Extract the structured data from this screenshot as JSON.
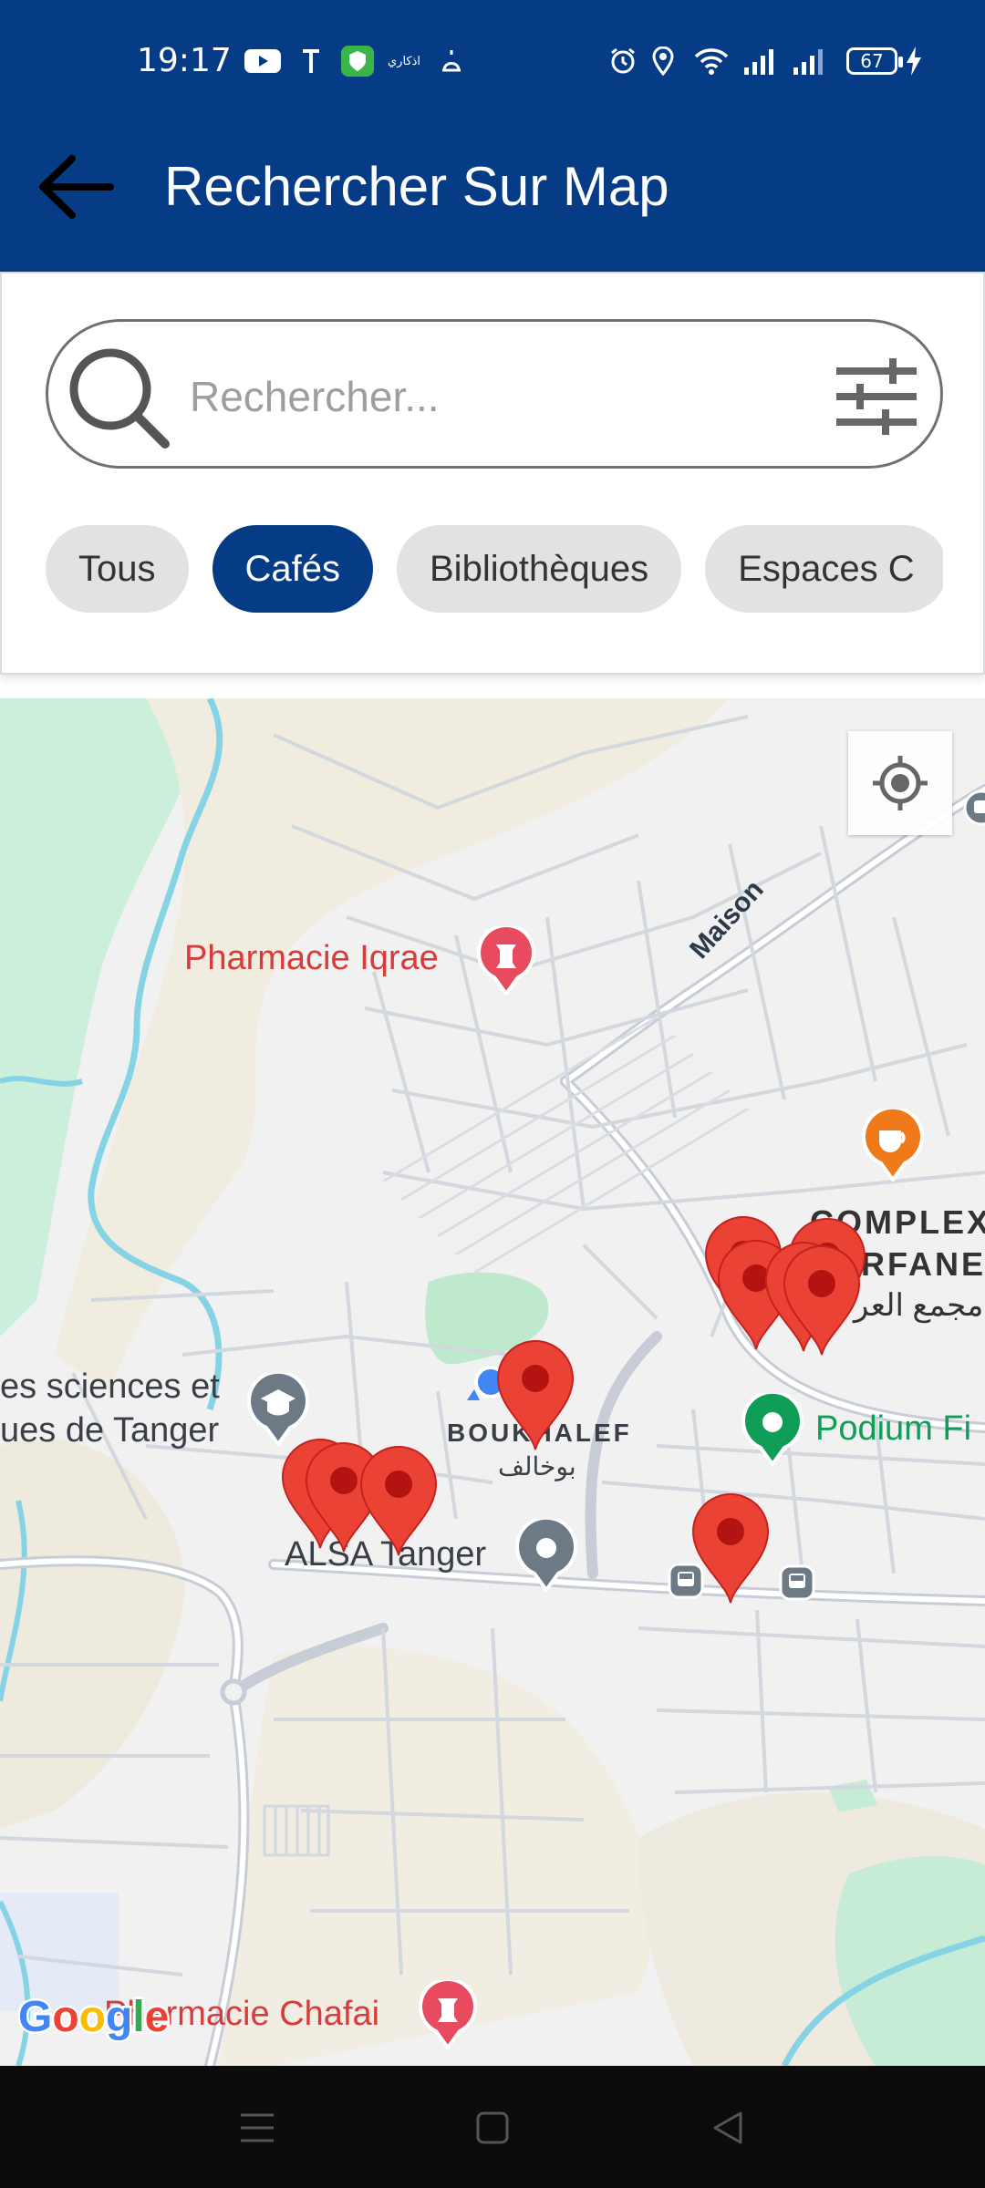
{
  "status_bar": {
    "time": "19:17",
    "battery": "67",
    "notification_text": "اذكاري"
  },
  "app_bar": {
    "title": "Rechercher Sur Map",
    "back_icon": "arrow-left-icon"
  },
  "search": {
    "placeholder": "Rechercher...",
    "value": "",
    "search_icon": "search-icon",
    "filter_icon": "sliders-icon"
  },
  "filters": {
    "chips": [
      {
        "label": "Tous",
        "active": false
      },
      {
        "label": "Cafés",
        "active": true
      },
      {
        "label": "Bibliothèques",
        "active": false
      },
      {
        "label": "Espaces C",
        "active": false
      }
    ]
  },
  "map": {
    "labels": {
      "pharmacie_iqrae": "Pharmacie Iqrae",
      "maison": "Maison",
      "complex_line1": "COMPLEX",
      "complex_line2": "RFANE",
      "complex_arabic": "مجمع العر",
      "sciences_line1": "es sciences et",
      "sciences_line2": "ues de Tanger",
      "boukhalef": "BOUKHALEF",
      "boukhalef_arabic": "بوخالف",
      "podium": "Podium Fi",
      "alsa": "ALSA Tanger",
      "pharmacie_chafai": "Pharmacie Chafai",
      "google": "Google"
    },
    "colors": {
      "marker": "#ea4335",
      "marker_dark": "#b31412",
      "pharmacy_label": "#d93b3b",
      "podium_label": "#0f9d58",
      "primary": "#063b86"
    }
  },
  "nav_bar": {
    "menu_icon": "menu-icon",
    "home_icon": "square-home-icon",
    "back_icon": "triangle-back-icon"
  }
}
